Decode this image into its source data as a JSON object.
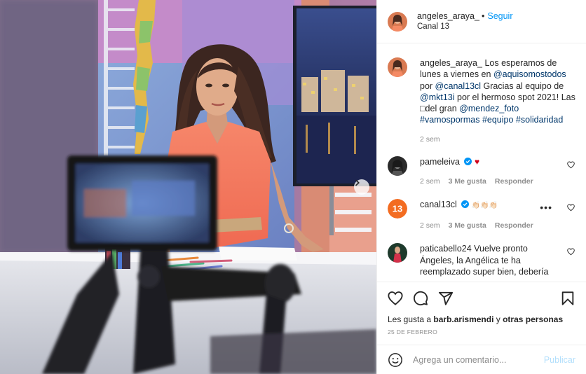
{
  "post": {
    "author": "angeles_araya_",
    "follow_label": "Seguir",
    "location": "Canal 13",
    "caption": {
      "username": "angeles_araya_",
      "parts": [
        {
          "t": " Los esperamos de lunes a viernes en ",
          "link": false
        },
        {
          "t": "@aquisomostodos",
          "link": true
        },
        {
          "t": " por ",
          "link": false
        },
        {
          "t": "@canal13cl",
          "link": true
        },
        {
          "t": " Gracias al equipo de ",
          "link": false
        },
        {
          "t": "@mkt13i",
          "link": true
        },
        {
          "t": " por el hermoso spot 2021! Las □del gran ",
          "link": false
        },
        {
          "t": "@mendez_foto",
          "link": true
        },
        {
          "t": " ",
          "link": false
        },
        {
          "t": "#vamospormas",
          "link": true
        },
        {
          "t": " ",
          "link": false
        },
        {
          "t": "#equipo",
          "link": true
        },
        {
          "t": " ",
          "link": false
        },
        {
          "t": "#solidaridad",
          "link": true
        }
      ],
      "time": "2 sem"
    },
    "comments": [
      {
        "username": "pameleiva",
        "text": "",
        "verified": true,
        "emoji": "♥",
        "time": "2 sem",
        "likes": "3 Me gusta",
        "reply": "Responder"
      },
      {
        "username": "canal13cl",
        "text": "👏🏻👏🏻👏🏻",
        "verified": true,
        "emoji": "",
        "time": "2 sem",
        "likes": "3 Me gusta",
        "reply": "Responder"
      },
      {
        "username": "paticabello24",
        "text": " Vuelve pronto Ángeles, la Angélica te ha reemplazado super bien, debería",
        "verified": false,
        "emoji": "",
        "time": "",
        "likes": "",
        "reply": ""
      }
    ],
    "likes": {
      "prefix": "Les gusta a ",
      "user": "barb.arismendi",
      "mid": " y ",
      "others": "otras personas"
    },
    "date": "25 DE FEBRERO",
    "composer": {
      "placeholder": "Agrega un comentario...",
      "publish": "Publicar"
    },
    "avatar_13_label": "13"
  },
  "icons": {
    "like": "heart-outline-icon",
    "comment": "speech-bubble-icon",
    "share": "paper-plane-icon",
    "save": "bookmark-icon",
    "next": "chevron-right-icon",
    "emoji": "smiley-icon",
    "verified": "verified-badge-icon"
  },
  "colors": {
    "link": "#00376b",
    "follow": "#0095f6",
    "publish_disabled": "#b2dffc",
    "muted": "#8e8e8e",
    "verified": "#0095f6",
    "canal13": "#f36c21"
  }
}
